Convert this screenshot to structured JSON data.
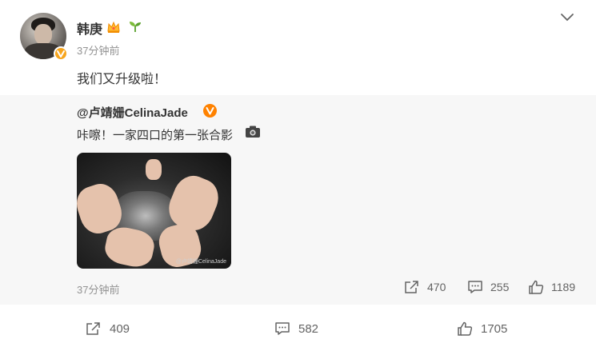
{
  "post": {
    "author": "韩庚",
    "time": "37分钟前",
    "text": "我们又升级啦！",
    "reposts": "409",
    "comments": "582",
    "likes": "1705"
  },
  "repost": {
    "author": "@卢靖姗CelinaJade",
    "text": "咔嚓！一家四口的第一张合影",
    "time": "37分钟前",
    "image_watermark": "@卢靖姗CelinaJade",
    "reposts": "470",
    "comments": "255",
    "likes": "1189"
  },
  "icons": {
    "verified": "verified-badge-icon",
    "vip": "crown-icon",
    "sprout": "sprout-icon",
    "more": "chevron-down-icon",
    "camera": "camera-icon",
    "repost": "repost-icon",
    "comment": "comment-icon",
    "like": "thumbs-up-icon"
  },
  "colors": {
    "verified_gold": "#f7a51d",
    "verified_orange": "#ff8200",
    "repost_bg": "#f7f7f7",
    "muted_text": "#939393"
  }
}
